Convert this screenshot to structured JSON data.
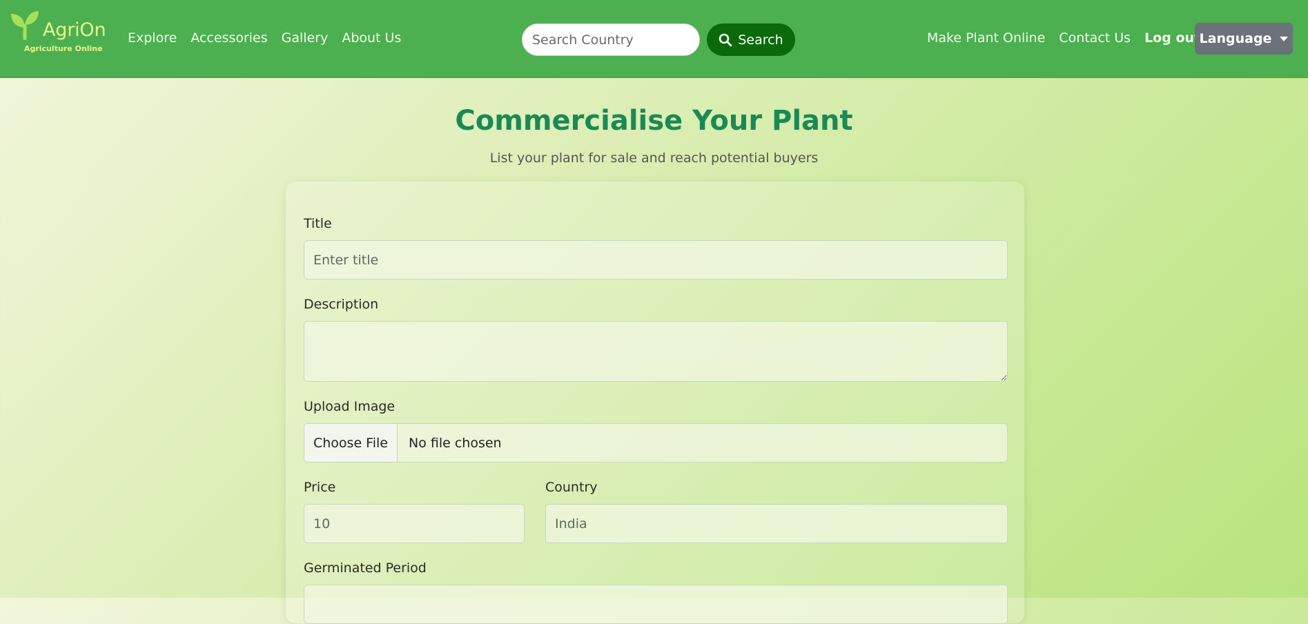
{
  "brand": {
    "name": "AgriOn",
    "tagline": "Agriculture Online"
  },
  "nav": {
    "left": [
      "Explore",
      "Accessories",
      "Gallery",
      "About Us"
    ],
    "right": [
      "Make Plant Online",
      "Contact Us",
      "Log out"
    ],
    "language_label": "Language"
  },
  "search": {
    "placeholder": "Search Country",
    "button_label": "Search"
  },
  "page": {
    "title": "Commercialise Your Plant",
    "subtitle": "List your plant for sale and reach potential buyers"
  },
  "form": {
    "title_label": "Title",
    "title_placeholder": "Enter title",
    "description_label": "Description",
    "upload_label": "Upload Image",
    "upload_button": "Choose File",
    "upload_status": "No file chosen",
    "price_label": "Price",
    "price_placeholder": "10",
    "country_label": "Country",
    "country_placeholder": "India",
    "germinated_label": "Germinated Period"
  },
  "colors": {
    "navbar": "#4caf50",
    "brand_accent": "#ecf58a",
    "search_button": "#0a6a0a",
    "language_button": "#6b727a",
    "title": "#1a8a55"
  },
  "icons": {
    "logo": "sprout-icon",
    "search": "search-icon",
    "dropdown": "caret-down-icon"
  }
}
